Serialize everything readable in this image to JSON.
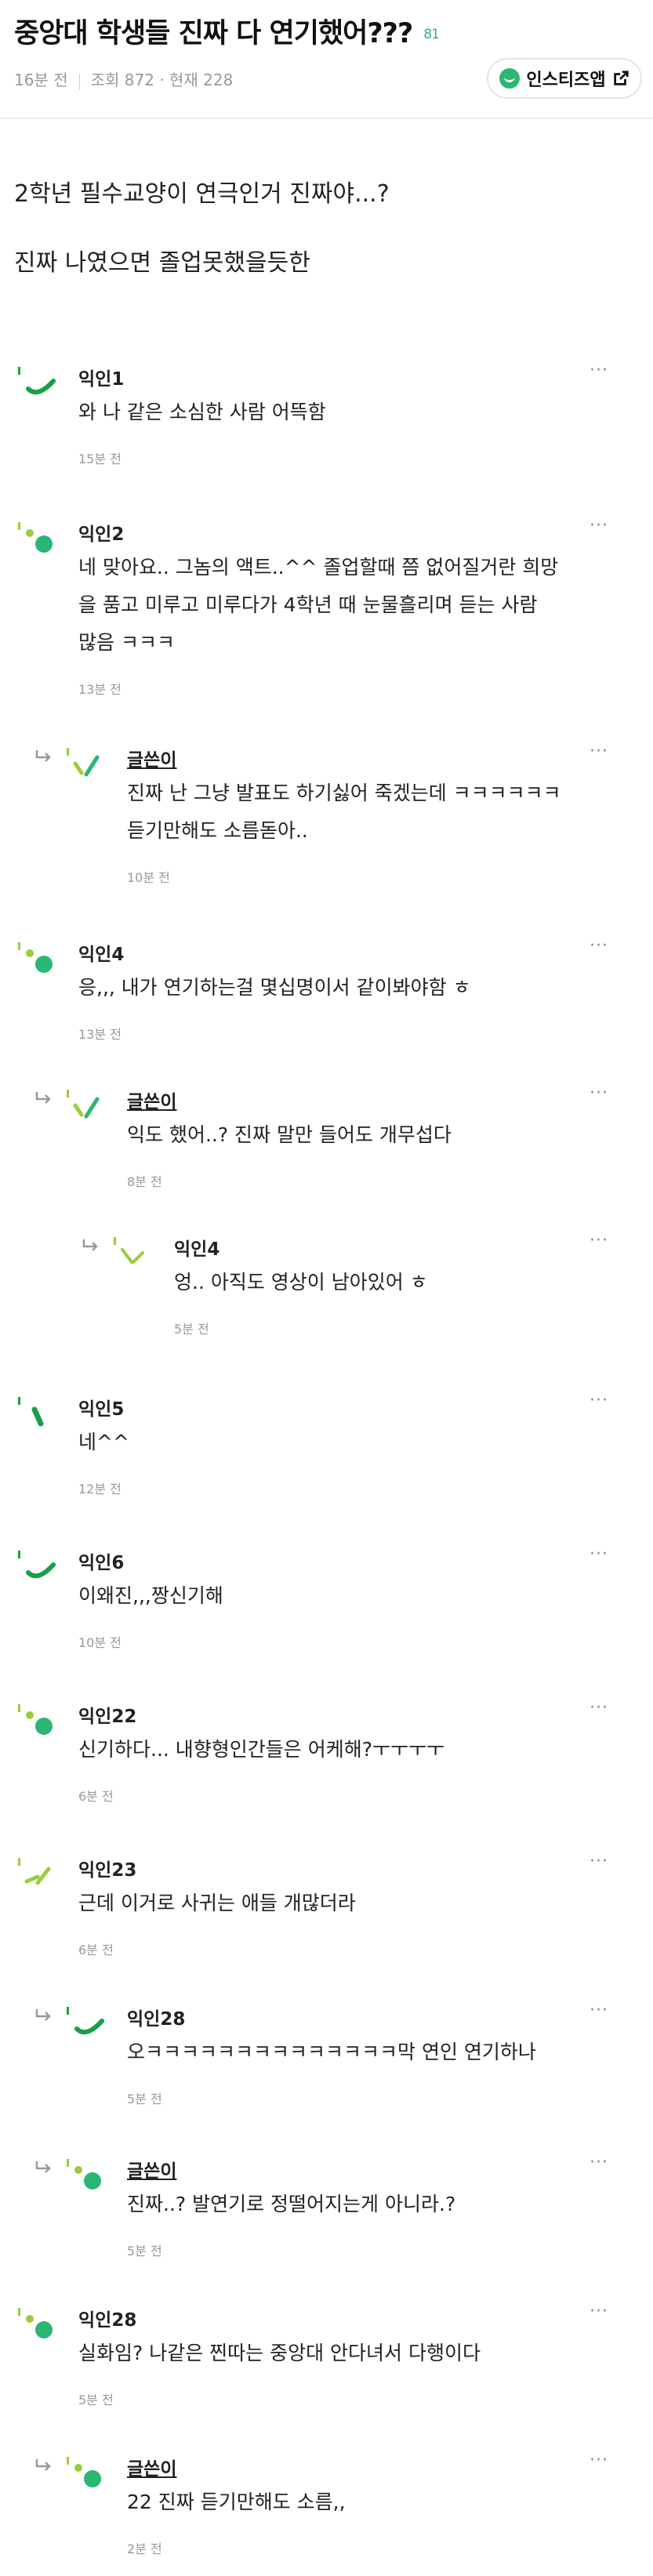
{
  "header": {
    "title": "중앙대 학생들 진짜 다 연기했어???",
    "comment_count": "81",
    "time": "16분 전",
    "views": "조회 872 · 현재 228",
    "app_button": "인스티즈앱"
  },
  "post": {
    "lines": [
      "2학년 필수교양이 연극인거 진짜야...?",
      "진짜 나였으면 졸업못했을듯한"
    ]
  },
  "colors": {
    "accent": "#2bb673",
    "light_green": "#9ccc3c",
    "dark_green": "#1a9e4a"
  },
  "comments": [
    {
      "name": "익인1",
      "author": false,
      "lines": [
        "와 나 같은 소심한 사람 어뜩함"
      ],
      "time": "15분 전"
    },
    {
      "name": "익인2",
      "author": false,
      "lines": [
        "네 맞아요.. 그놈의 액트..^^ 졸업할때 쯤 없어질거란 희망",
        "을 품고 미루고 미루다가 4학년 때 눈물흘리며 듣는 사람",
        "많음 ㅋㅋㅋ"
      ],
      "time": "13분 전"
    },
    {
      "name": "글쓴이",
      "author": true,
      "lines": [
        "진짜 난 그냥 발표도 하기싫어 죽겠는데 ㅋㅋㅋㅋㅋㅋ",
        "듣기만해도 소름돋아.."
      ],
      "time": "10분 전"
    },
    {
      "name": "익인4",
      "author": false,
      "lines": [
        "응,,, 내가 연기하는걸 몇십명이서 같이봐야함 ㅎ"
      ],
      "time": "13분 전"
    },
    {
      "name": "글쓴이",
      "author": true,
      "lines": [
        "익도 했어..? 진짜 말만 들어도 개무섭다"
      ],
      "time": "8분 전"
    },
    {
      "name": "익인4",
      "author": false,
      "lines": [
        "엉.. 아직도 영상이 남아있어 ㅎ"
      ],
      "time": "5분 전"
    },
    {
      "name": "익인5",
      "author": false,
      "lines": [
        "네^^"
      ],
      "time": "12분 전"
    },
    {
      "name": "익인6",
      "author": false,
      "lines": [
        "이왜진,,,짱신기해"
      ],
      "time": "10분 전"
    },
    {
      "name": "익인22",
      "author": false,
      "lines": [
        "신기하다... 내향형인간들은 어케해?ㅜㅜㅜㅜ"
      ],
      "time": "6분 전"
    },
    {
      "name": "익인23",
      "author": false,
      "lines": [
        "근데 이거로 사귀는 애들 개많더라"
      ],
      "time": "6분 전"
    },
    {
      "name": "익인28",
      "author": false,
      "lines": [
        "오ㅋㅋㅋㅋㅋㅋㅋㅋㅋㅋㅋㅋㅋㅋ막 연인 연기하나"
      ],
      "time": "5분 전"
    },
    {
      "name": "글쓴이",
      "author": true,
      "lines": [
        "진짜..? 발연기로 정떨어지는게 아니라.?"
      ],
      "time": "5분 전"
    },
    {
      "name": "익인28",
      "author": false,
      "lines": [
        "실화임? 나같은 찐따는 중앙대 안다녀서 다행이다"
      ],
      "time": "5분 전"
    },
    {
      "name": "글쓴이",
      "author": true,
      "lines": [
        "22 진짜 듣기만해도 소름,,"
      ],
      "time": "2분 전"
    }
  ],
  "icons": {
    "more": "more-dots-icon",
    "reply": "reply-arrow-icon",
    "external": "external-link-icon"
  }
}
